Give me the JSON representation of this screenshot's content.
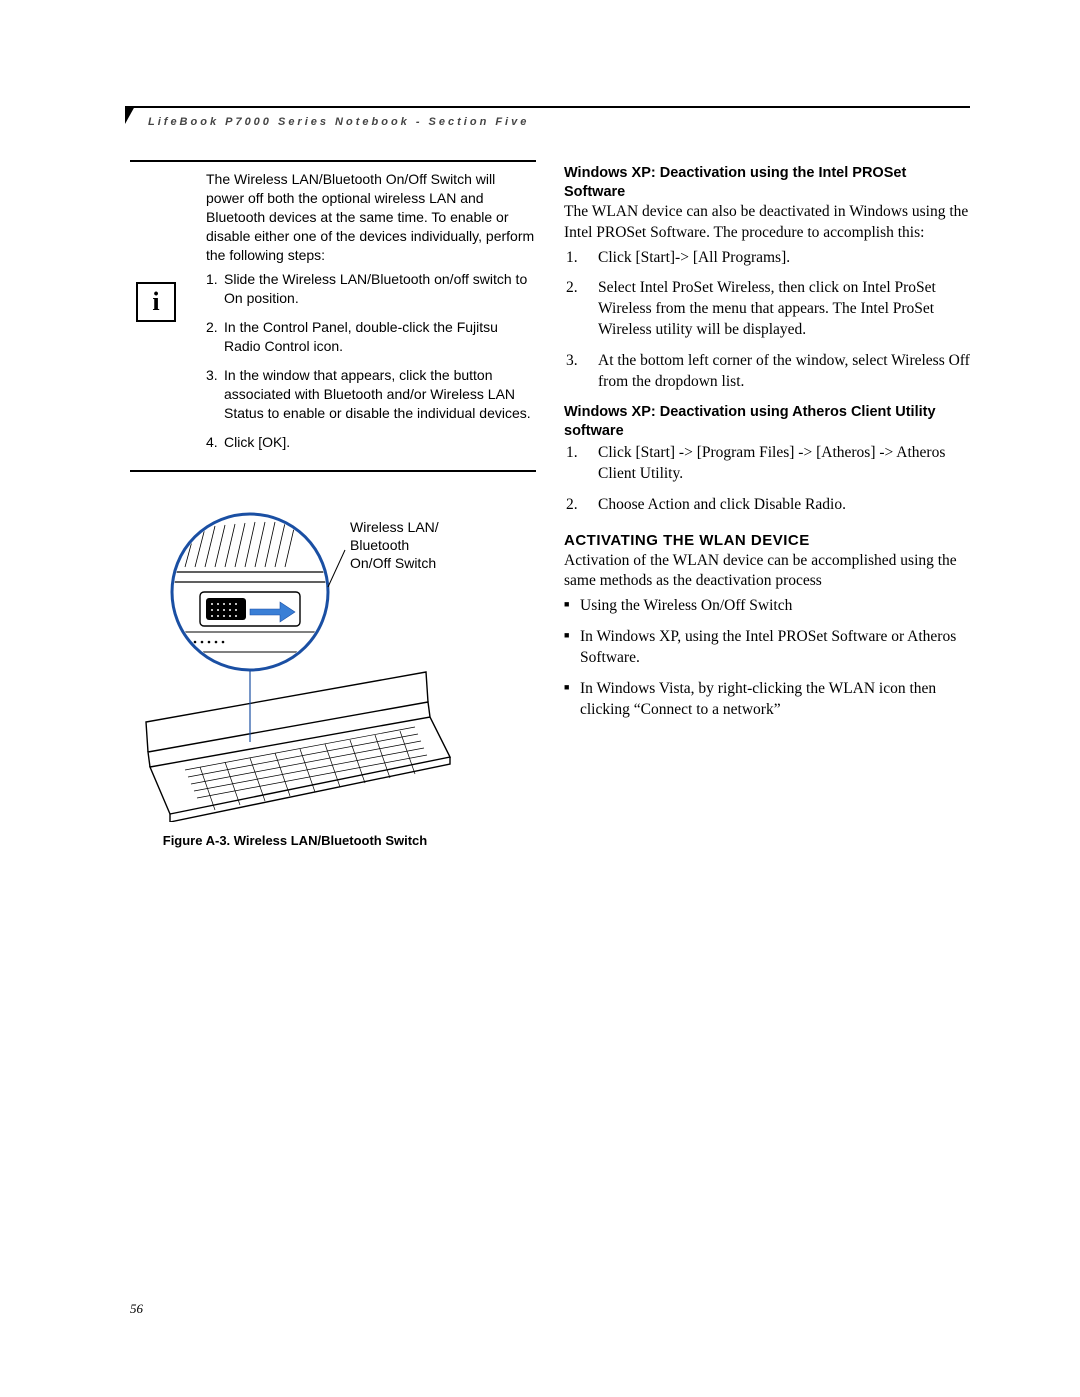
{
  "running_head": "LifeBook P7000 Series Notebook - Section Five",
  "page_number": "56",
  "note": {
    "intro": "The Wireless LAN/Bluetooth On/Off Switch will power off both the optional wireless LAN and Bluetooth devices at the same time. To enable or disable either one of the devices individually, perform the following steps:",
    "steps": [
      "Slide the Wireless LAN/Bluetooth on/off switch to On position.",
      "In the Control Panel, double-click the Fujitsu Radio Control icon.",
      "In the window that appears, click the button associated with Bluetooth and/or Wireless LAN Status to enable or disable the individual devices.",
      "Click [OK]."
    ]
  },
  "figure": {
    "callout": "Wireless LAN/\nBluetooth\nOn/Off Switch",
    "caption": "Figure A-3. Wireless LAN/Bluetooth Switch"
  },
  "right": {
    "h1": "Windows XP: Deactivation using the Intel PROSet Software",
    "p1": "The WLAN device can also be deactivated in Windows using the Intel PROSet Software. The procedure to accomplish this:",
    "list1": [
      "Click [Start]-> [All Programs].",
      "Select Intel ProSet Wireless, then click on Intel ProSet Wireless from the menu that appears. The Intel ProSet Wireless utility will be displayed.",
      "At the bottom left corner of the window, select Wireless Off from the dropdown list."
    ],
    "h2": "Windows XP: Deactivation using Atheros Client Utility software",
    "list2": [
      "Click [Start] -> [Program Files] -> [Atheros] -> Atheros Client Utility.",
      "Choose Action and click Disable Radio."
    ],
    "section": "ACTIVATING THE WLAN DEVICE",
    "p2": "Activation of the WLAN device can be accomplished using the same methods as the deactivation process",
    "bullets": [
      "Using the Wireless On/Off Switch",
      "In Windows XP, using the Intel PROSet Software or Atheros Software.",
      "In Windows Vista, by right-clicking the WLAN icon then clicking “Connect to a network”"
    ]
  }
}
